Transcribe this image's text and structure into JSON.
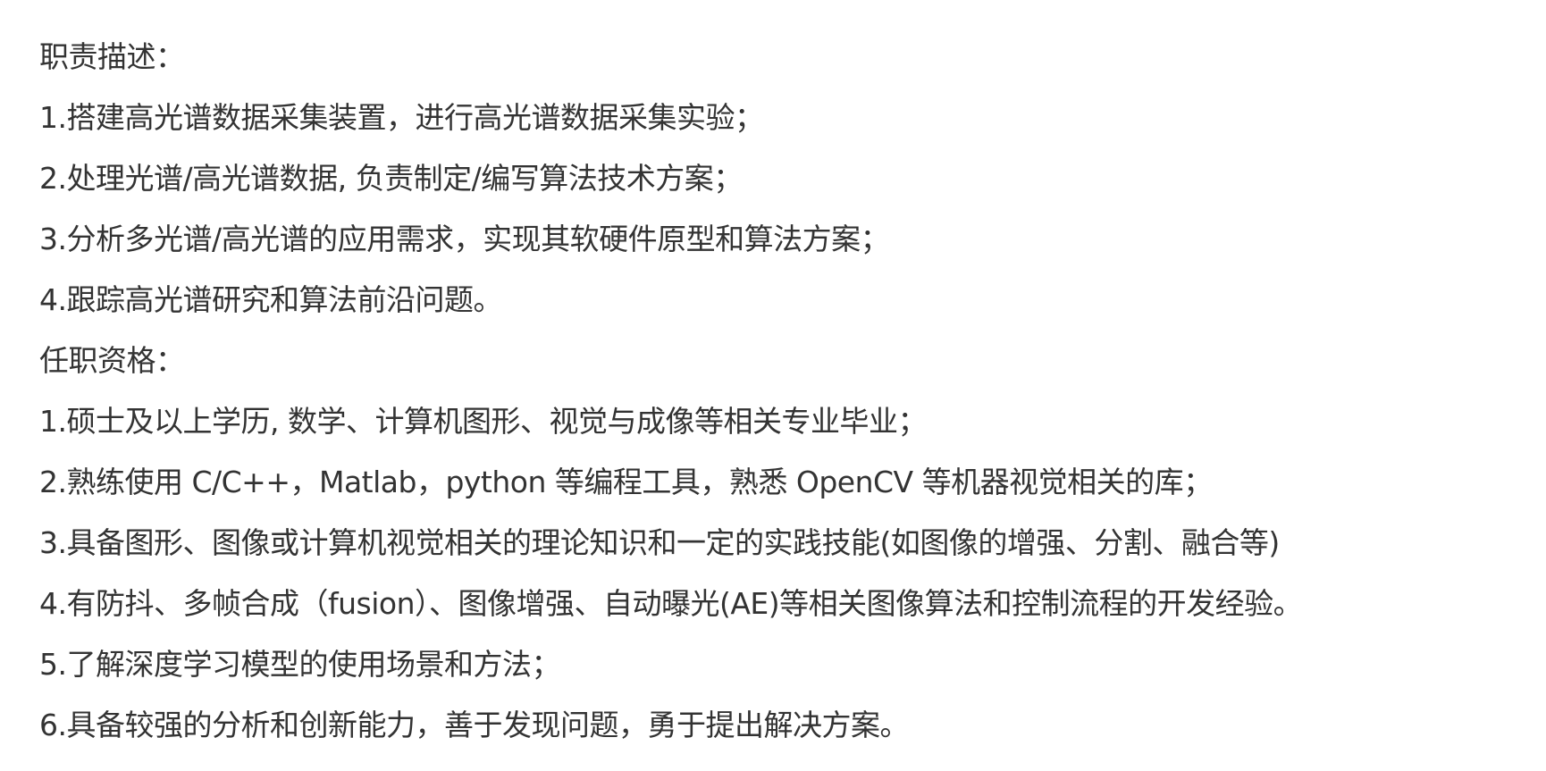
{
  "job": {
    "duties_heading": "职责描述：",
    "duties": [
      "1.搭建高光谱数据采集装置，进行高光谱数据采集实验；",
      "2.处理光谱/高光谱数据, 负责制定/编写算法技术方案；",
      "3.分析多光谱/高光谱的应用需求，实现其软硬件原型和算法方案；",
      "4.跟踪高光谱研究和算法前沿问题。"
    ],
    "requirements_heading": "任职资格：",
    "requirements": [
      "1.硕士及以上学历, 数学、计算机图形、视觉与成像等相关专业毕业；",
      "2.熟练使用 C/C++，Matlab，python 等编程工具，熟悉 OpenCV 等机器视觉相关的库；",
      "3.具备图形、图像或计算机视觉相关的理论知识和一定的实践技能(如图像的增强、分割、融合等)",
      "4.有防抖、多帧合成（fusion）、图像增强、自动曝光(AE)等相关图像算法和控制流程的开发经验。",
      "5.了解深度学习模型的使用场景和方法；",
      "6.具备较强的分析和创新能力，善于发现问题，勇于提出解决方案。"
    ]
  }
}
